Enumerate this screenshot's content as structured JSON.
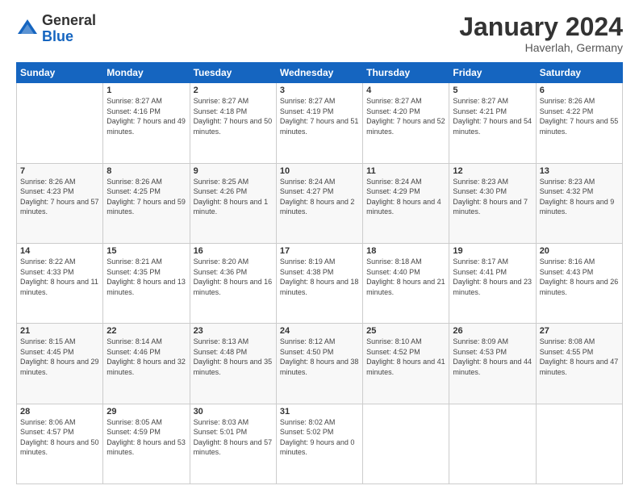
{
  "logo": {
    "general": "General",
    "blue": "Blue"
  },
  "header": {
    "month": "January 2024",
    "location": "Haverlah, Germany"
  },
  "weekdays": [
    "Sunday",
    "Monday",
    "Tuesday",
    "Wednesday",
    "Thursday",
    "Friday",
    "Saturday"
  ],
  "weeks": [
    [
      {
        "day": "",
        "sunrise": "",
        "sunset": "",
        "daylight": ""
      },
      {
        "day": "1",
        "sunrise": "Sunrise: 8:27 AM",
        "sunset": "Sunset: 4:16 PM",
        "daylight": "Daylight: 7 hours and 49 minutes."
      },
      {
        "day": "2",
        "sunrise": "Sunrise: 8:27 AM",
        "sunset": "Sunset: 4:18 PM",
        "daylight": "Daylight: 7 hours and 50 minutes."
      },
      {
        "day": "3",
        "sunrise": "Sunrise: 8:27 AM",
        "sunset": "Sunset: 4:19 PM",
        "daylight": "Daylight: 7 hours and 51 minutes."
      },
      {
        "day": "4",
        "sunrise": "Sunrise: 8:27 AM",
        "sunset": "Sunset: 4:20 PM",
        "daylight": "Daylight: 7 hours and 52 minutes."
      },
      {
        "day": "5",
        "sunrise": "Sunrise: 8:27 AM",
        "sunset": "Sunset: 4:21 PM",
        "daylight": "Daylight: 7 hours and 54 minutes."
      },
      {
        "day": "6",
        "sunrise": "Sunrise: 8:26 AM",
        "sunset": "Sunset: 4:22 PM",
        "daylight": "Daylight: 7 hours and 55 minutes."
      }
    ],
    [
      {
        "day": "7",
        "sunrise": "Sunrise: 8:26 AM",
        "sunset": "Sunset: 4:23 PM",
        "daylight": "Daylight: 7 hours and 57 minutes."
      },
      {
        "day": "8",
        "sunrise": "Sunrise: 8:26 AM",
        "sunset": "Sunset: 4:25 PM",
        "daylight": "Daylight: 7 hours and 59 minutes."
      },
      {
        "day": "9",
        "sunrise": "Sunrise: 8:25 AM",
        "sunset": "Sunset: 4:26 PM",
        "daylight": "Daylight: 8 hours and 1 minute."
      },
      {
        "day": "10",
        "sunrise": "Sunrise: 8:24 AM",
        "sunset": "Sunset: 4:27 PM",
        "daylight": "Daylight: 8 hours and 2 minutes."
      },
      {
        "day": "11",
        "sunrise": "Sunrise: 8:24 AM",
        "sunset": "Sunset: 4:29 PM",
        "daylight": "Daylight: 8 hours and 4 minutes."
      },
      {
        "day": "12",
        "sunrise": "Sunrise: 8:23 AM",
        "sunset": "Sunset: 4:30 PM",
        "daylight": "Daylight: 8 hours and 7 minutes."
      },
      {
        "day": "13",
        "sunrise": "Sunrise: 8:23 AM",
        "sunset": "Sunset: 4:32 PM",
        "daylight": "Daylight: 8 hours and 9 minutes."
      }
    ],
    [
      {
        "day": "14",
        "sunrise": "Sunrise: 8:22 AM",
        "sunset": "Sunset: 4:33 PM",
        "daylight": "Daylight: 8 hours and 11 minutes."
      },
      {
        "day": "15",
        "sunrise": "Sunrise: 8:21 AM",
        "sunset": "Sunset: 4:35 PM",
        "daylight": "Daylight: 8 hours and 13 minutes."
      },
      {
        "day": "16",
        "sunrise": "Sunrise: 8:20 AM",
        "sunset": "Sunset: 4:36 PM",
        "daylight": "Daylight: 8 hours and 16 minutes."
      },
      {
        "day": "17",
        "sunrise": "Sunrise: 8:19 AM",
        "sunset": "Sunset: 4:38 PM",
        "daylight": "Daylight: 8 hours and 18 minutes."
      },
      {
        "day": "18",
        "sunrise": "Sunrise: 8:18 AM",
        "sunset": "Sunset: 4:40 PM",
        "daylight": "Daylight: 8 hours and 21 minutes."
      },
      {
        "day": "19",
        "sunrise": "Sunrise: 8:17 AM",
        "sunset": "Sunset: 4:41 PM",
        "daylight": "Daylight: 8 hours and 23 minutes."
      },
      {
        "day": "20",
        "sunrise": "Sunrise: 8:16 AM",
        "sunset": "Sunset: 4:43 PM",
        "daylight": "Daylight: 8 hours and 26 minutes."
      }
    ],
    [
      {
        "day": "21",
        "sunrise": "Sunrise: 8:15 AM",
        "sunset": "Sunset: 4:45 PM",
        "daylight": "Daylight: 8 hours and 29 minutes."
      },
      {
        "day": "22",
        "sunrise": "Sunrise: 8:14 AM",
        "sunset": "Sunset: 4:46 PM",
        "daylight": "Daylight: 8 hours and 32 minutes."
      },
      {
        "day": "23",
        "sunrise": "Sunrise: 8:13 AM",
        "sunset": "Sunset: 4:48 PM",
        "daylight": "Daylight: 8 hours and 35 minutes."
      },
      {
        "day": "24",
        "sunrise": "Sunrise: 8:12 AM",
        "sunset": "Sunset: 4:50 PM",
        "daylight": "Daylight: 8 hours and 38 minutes."
      },
      {
        "day": "25",
        "sunrise": "Sunrise: 8:10 AM",
        "sunset": "Sunset: 4:52 PM",
        "daylight": "Daylight: 8 hours and 41 minutes."
      },
      {
        "day": "26",
        "sunrise": "Sunrise: 8:09 AM",
        "sunset": "Sunset: 4:53 PM",
        "daylight": "Daylight: 8 hours and 44 minutes."
      },
      {
        "day": "27",
        "sunrise": "Sunrise: 8:08 AM",
        "sunset": "Sunset: 4:55 PM",
        "daylight": "Daylight: 8 hours and 47 minutes."
      }
    ],
    [
      {
        "day": "28",
        "sunrise": "Sunrise: 8:06 AM",
        "sunset": "Sunset: 4:57 PM",
        "daylight": "Daylight: 8 hours and 50 minutes."
      },
      {
        "day": "29",
        "sunrise": "Sunrise: 8:05 AM",
        "sunset": "Sunset: 4:59 PM",
        "daylight": "Daylight: 8 hours and 53 minutes."
      },
      {
        "day": "30",
        "sunrise": "Sunrise: 8:03 AM",
        "sunset": "Sunset: 5:01 PM",
        "daylight": "Daylight: 8 hours and 57 minutes."
      },
      {
        "day": "31",
        "sunrise": "Sunrise: 8:02 AM",
        "sunset": "Sunset: 5:02 PM",
        "daylight": "Daylight: 9 hours and 0 minutes."
      },
      {
        "day": "",
        "sunrise": "",
        "sunset": "",
        "daylight": ""
      },
      {
        "day": "",
        "sunrise": "",
        "sunset": "",
        "daylight": ""
      },
      {
        "day": "",
        "sunrise": "",
        "sunset": "",
        "daylight": ""
      }
    ]
  ]
}
